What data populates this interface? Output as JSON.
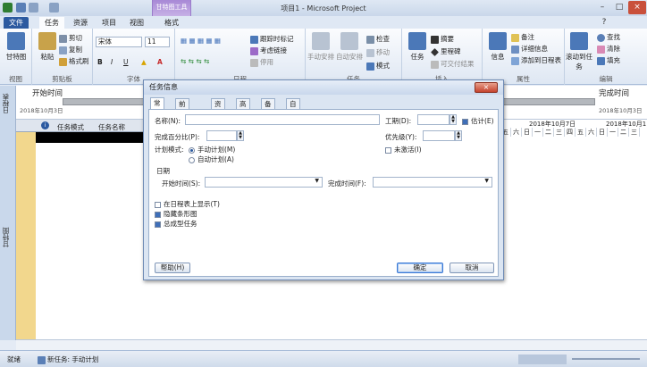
{
  "window": {
    "title": "项目1 - Microsoft Project",
    "context_group": "甘特图工具"
  },
  "tabs": [
    "文件",
    "任务",
    "资源",
    "项目",
    "视图",
    "格式"
  ],
  "ribbon": {
    "view": {
      "big": "甘特图",
      "label": "视图"
    },
    "clipboard": {
      "paste": "粘贴",
      "cut": "剪切",
      "copy": "复制",
      "format_painter": "格式刷",
      "label": "剪贴板"
    },
    "font": {
      "name": "宋体",
      "size": "11",
      "label": "字体"
    },
    "schedule": {
      "track": "跟踪时标记",
      "respect": "考虑链接",
      "inactivate": "停用",
      "label": "日程"
    },
    "tasks": {
      "manual": "手动安排",
      "auto": "自动安排",
      "inspect": "检查",
      "move": "移动",
      "mode": "模式",
      "label": "任务"
    },
    "insert": {
      "task": "任务",
      "summary": "摘要",
      "milestone": "里程碑",
      "deliverable": "可交付结果",
      "label": "插入"
    },
    "properties": {
      "info": "信息",
      "notes": "备注",
      "details": "详细信息",
      "add_timeline": "添加到日程表",
      "label": "属性"
    },
    "editing": {
      "scroll": "滚动到任务",
      "find": "查找",
      "clear": "清除",
      "fill": "填充",
      "label": "编辑"
    }
  },
  "side": {
    "timeline": "日程表",
    "gantt": "甘特图"
  },
  "timeline": {
    "start_label": "开始时间",
    "start_date": "2018年10月3日",
    "end_label": "完成时间",
    "end_date": "2018年10月3日"
  },
  "grid": {
    "col_mode": "任务模式",
    "col_name": "任务名称"
  },
  "gantt": {
    "week1": "2018年10月7日",
    "week2": "2018年10月1",
    "days": [
      "五",
      "六",
      "日",
      "一",
      "二",
      "三",
      "四",
      "五",
      "六",
      "日",
      "一",
      "二",
      "三"
    ]
  },
  "status": {
    "ready": "就绪",
    "new_tasks": "新任务: 手动计划"
  },
  "dialog": {
    "title": "任务信息",
    "tabs": [
      "常规",
      "前置任务",
      "资源",
      "高级",
      "备注",
      "自定义域"
    ],
    "name_label": "名称(N):",
    "duration_label": "工期(D):",
    "estimated_label": "估计(E)",
    "pct_label": "完成百分比(P):",
    "priority_label": "优先级(Y):",
    "schedule_mode_label": "计划模式:",
    "manual": "手动计划(M)",
    "auto": "自动计划(A)",
    "inactive": "未激活(I)",
    "dates_label": "日期",
    "start_label": "开始时间(S):",
    "finish_label": "完成时间(F):",
    "show_timeline": "在日程表上显示(T)",
    "hide_bar": "隐藏条形图",
    "rollup": "总成型任务",
    "help": "帮助(H)",
    "ok": "确定",
    "cancel": "取消"
  },
  "colors": {
    "accent": "#2c5aa0",
    "context": "#a889d6",
    "selected_row": "#000000"
  }
}
